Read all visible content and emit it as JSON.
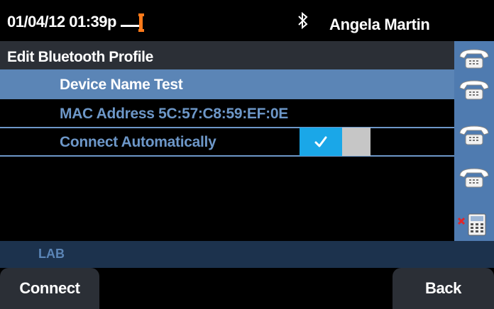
{
  "status": {
    "datetime": "01/04/12 01:39p",
    "user": "Angela Martin"
  },
  "title": "Edit Bluetooth Profile",
  "list": {
    "device_name": "Device Name Test",
    "mac_address": "MAC Address 5C:57:C8:59:EF:0E",
    "connect_auto_label": "Connect Automatically",
    "connect_auto_on": true
  },
  "line_label": "LAB",
  "softkeys": {
    "connect": "Connect",
    "back": "Back"
  },
  "linekeys": [
    {
      "icon": "phone-handset-icon"
    },
    {
      "icon": "phone-handset-icon"
    },
    {
      "icon": "phone-handset-icon"
    },
    {
      "icon": "phone-handset-icon"
    },
    {
      "icon": "unregistered-line-icon"
    }
  ],
  "colors": {
    "accent_blue": "#5b85b6",
    "toggle_on": "#1aa7e8",
    "text_blue": "#6d97c8"
  }
}
